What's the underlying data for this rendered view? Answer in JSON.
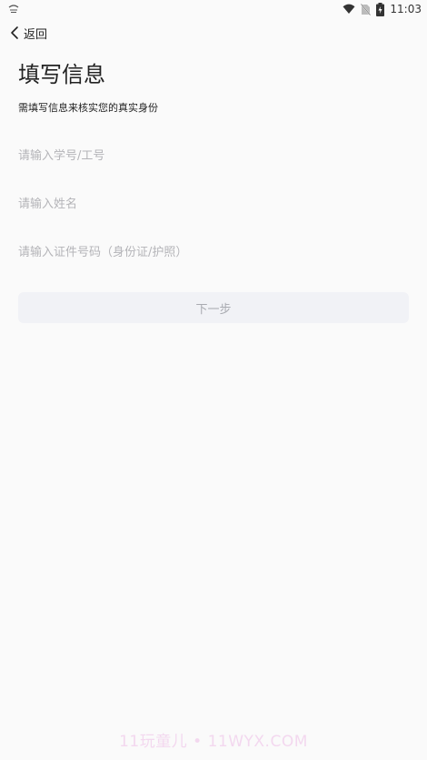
{
  "status_bar": {
    "time": "11:03",
    "icons": [
      "notification-icon",
      "wifi-icon",
      "no-sim-icon",
      "battery-charging-icon"
    ]
  },
  "nav": {
    "back_label": "返回",
    "back_icon": "chevron-left-icon"
  },
  "header": {
    "title": "填写信息",
    "subtitle": "需填写信息来核实您的真实身份"
  },
  "form": {
    "student_id_placeholder": "请输入学号/工号",
    "name_placeholder": "请输入姓名",
    "id_number_placeholder": "请输入证件号码（身份证/护照）",
    "next_label": "下一步"
  },
  "colors": {
    "background": "#fafafa",
    "placeholder": "#b4b4b8",
    "button_bg": "#f1f2f6",
    "button_text": "#a9abb1"
  },
  "watermark": {
    "text": "11玩童儿 • 11WYX.COM"
  }
}
